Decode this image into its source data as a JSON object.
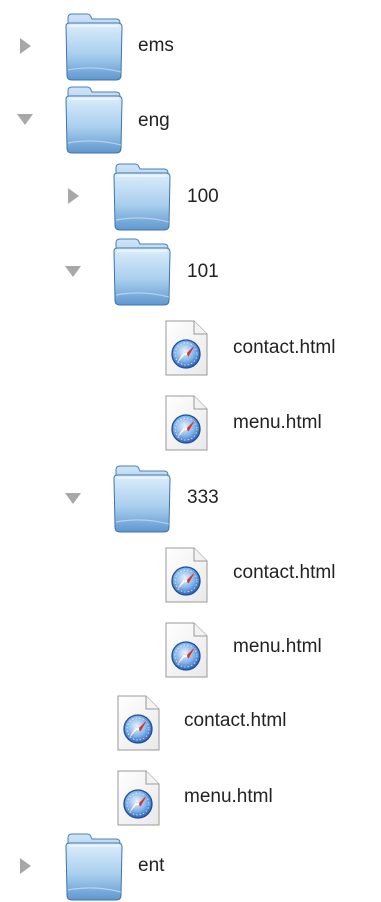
{
  "tree": {
    "ems": {
      "label": "ems",
      "expanded": false
    },
    "eng": {
      "label": "eng",
      "expanded": true,
      "f100": {
        "label": "100",
        "expanded": false
      },
      "f101": {
        "label": "101",
        "expanded": true,
        "contact": "contact.html",
        "menu": "menu.html"
      },
      "f333": {
        "label": "333",
        "expanded": true,
        "contact": "contact.html",
        "menu": "menu.html"
      },
      "contact": "contact.html",
      "menu": "menu.html"
    },
    "ent": {
      "label": "ent",
      "expanded": false
    }
  },
  "icons": {
    "folder": "folder-icon",
    "html_file": "html-document-icon",
    "collapsed": "disclosure-collapsed-icon",
    "expanded": "disclosure-expanded-icon"
  },
  "colors": {
    "folder_light": "#e2f0fb",
    "folder_mid": "#9cc8ea",
    "folder_dark": "#4f87c2",
    "disclosure": "#a8a8a8",
    "compass_blue": "#2d6fc4"
  }
}
